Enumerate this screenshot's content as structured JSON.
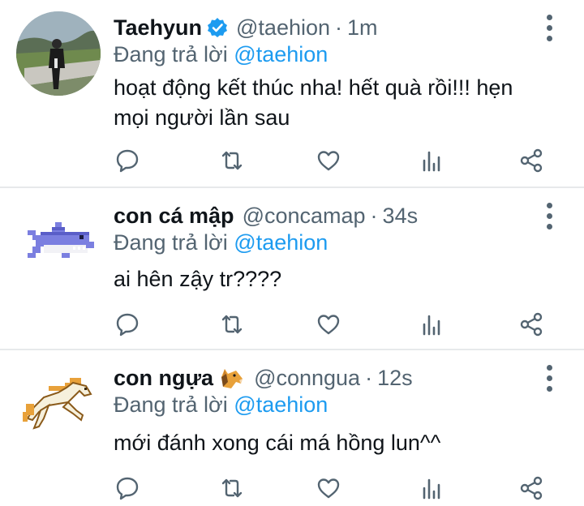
{
  "tweets": [
    {
      "name": "Taehyun",
      "verified": true,
      "handle": "@taehion",
      "time": "1m",
      "reply_prefix": "Đang trả lời",
      "reply_to": "@taehion",
      "text_line1": "hoạt động kết thúc nha! hết quà rồi!!! hẹn",
      "text_line2": "mọi người lần sau",
      "avatar": "photo-avatar"
    },
    {
      "name": "con cá mập",
      "handle": "@concamap",
      "time": "34s",
      "reply_prefix": "Đang trả lời",
      "reply_to": "@taehion",
      "text_line1": "ai hên zậy tr????",
      "avatar": "pixel-shark-avatar"
    },
    {
      "name": "con ngựa",
      "name_emoji": "horse-face-emoji",
      "handle": "@conngua",
      "time": "12s",
      "reply_prefix": "Đang trả lời",
      "reply_to": "@taehion",
      "text_line1": "mới đánh xong cái má hồng lun^^",
      "avatar": "pixel-horse-avatar"
    }
  ],
  "separator": "·",
  "actions": [
    "reply-icon",
    "retweet-icon",
    "like-icon",
    "analytics-icon",
    "share-icon"
  ],
  "colors": {
    "text": "#0f1419",
    "secondary": "#536471",
    "mention": "#1d9bf0",
    "verified": "#1d9bf0",
    "divider": "#e7e9eb"
  }
}
